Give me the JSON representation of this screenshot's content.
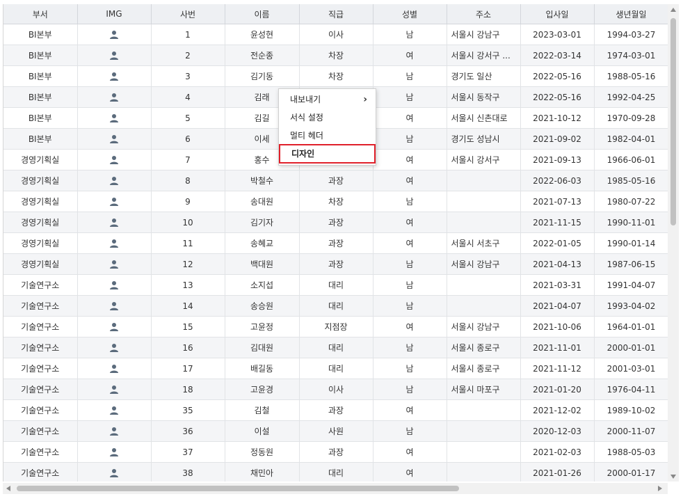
{
  "columns": [
    "부서",
    "IMG",
    "사번",
    "이름",
    "직급",
    "성별",
    "주소",
    "입사일",
    "생년월일"
  ],
  "rows": [
    {
      "dept": "BI본부",
      "id": "1",
      "name": "윤성현",
      "rank": "이사",
      "gender": "남",
      "addr": "서울시 강남구",
      "hire": "2023-03-01",
      "birth": "1994-03-27"
    },
    {
      "dept": "BI본부",
      "id": "2",
      "name": "전순종",
      "rank": "차장",
      "gender": "여",
      "addr": "서울시 강서구 ...",
      "hire": "2022-03-14",
      "birth": "1974-03-01"
    },
    {
      "dept": "BI본부",
      "id": "3",
      "name": "김기동",
      "rank": "차장",
      "gender": "남",
      "addr": "경기도 일산",
      "hire": "2022-05-16",
      "birth": "1988-05-16"
    },
    {
      "dept": "BI본부",
      "id": "4",
      "name": "김래",
      "rank": "",
      "gender": "남",
      "addr": "서울시 동작구",
      "hire": "2022-05-16",
      "birth": "1992-04-25"
    },
    {
      "dept": "BI본부",
      "id": "5",
      "name": "김길",
      "rank": "",
      "gender": "여",
      "addr": "서울시 신촌대로",
      "hire": "2021-10-12",
      "birth": "1970-09-28"
    },
    {
      "dept": "BI본부",
      "id": "6",
      "name": "이세",
      "rank": "",
      "gender": "남",
      "addr": "경기도 성남시",
      "hire": "2021-09-02",
      "birth": "1982-04-01"
    },
    {
      "dept": "경영기획실",
      "id": "7",
      "name": "홍수",
      "rank": "",
      "gender": "여",
      "addr": "서울시 강서구",
      "hire": "2021-09-13",
      "birth": "1966-06-01"
    },
    {
      "dept": "경영기획실",
      "id": "8",
      "name": "박철수",
      "rank": "과장",
      "gender": "여",
      "addr": "",
      "hire": "2022-06-03",
      "birth": "1985-05-16"
    },
    {
      "dept": "경영기획실",
      "id": "9",
      "name": "송대원",
      "rank": "차장",
      "gender": "남",
      "addr": "",
      "hire": "2021-07-13",
      "birth": "1980-07-22"
    },
    {
      "dept": "경영기획실",
      "id": "10",
      "name": "김기자",
      "rank": "과장",
      "gender": "여",
      "addr": "",
      "hire": "2021-11-15",
      "birth": "1990-11-01"
    },
    {
      "dept": "경영기획실",
      "id": "11",
      "name": "송혜교",
      "rank": "과장",
      "gender": "여",
      "addr": "서울시 서초구",
      "hire": "2022-01-05",
      "birth": "1990-01-14"
    },
    {
      "dept": "경영기획실",
      "id": "12",
      "name": "백대원",
      "rank": "과장",
      "gender": "남",
      "addr": "서울시 강남구",
      "hire": "2021-04-13",
      "birth": "1987-06-15"
    },
    {
      "dept": "기술연구소",
      "id": "13",
      "name": "소지섭",
      "rank": "대리",
      "gender": "남",
      "addr": "",
      "hire": "2021-03-31",
      "birth": "1991-04-07"
    },
    {
      "dept": "기술연구소",
      "id": "14",
      "name": "송승원",
      "rank": "대리",
      "gender": "남",
      "addr": "",
      "hire": "2021-04-07",
      "birth": "1993-04-02"
    },
    {
      "dept": "기술연구소",
      "id": "15",
      "name": "고윤정",
      "rank": "지점장",
      "gender": "여",
      "addr": "서울시 강남구",
      "hire": "2021-10-06",
      "birth": "1964-01-01"
    },
    {
      "dept": "기술연구소",
      "id": "16",
      "name": "김대원",
      "rank": "대리",
      "gender": "남",
      "addr": "서울시 종로구",
      "hire": "2021-11-01",
      "birth": "2000-01-01"
    },
    {
      "dept": "기술연구소",
      "id": "17",
      "name": "배길동",
      "rank": "대리",
      "gender": "남",
      "addr": "서울시 종로구",
      "hire": "2021-11-12",
      "birth": "2001-03-01"
    },
    {
      "dept": "기술연구소",
      "id": "18",
      "name": "고윤경",
      "rank": "이사",
      "gender": "남",
      "addr": "서울시 마포구",
      "hire": "2021-01-20",
      "birth": "1976-04-11"
    },
    {
      "dept": "기술연구소",
      "id": "35",
      "name": "김철",
      "rank": "과장",
      "gender": "여",
      "addr": "",
      "hire": "2021-12-02",
      "birth": "1989-10-02"
    },
    {
      "dept": "기술연구소",
      "id": "36",
      "name": "이설",
      "rank": "사원",
      "gender": "남",
      "addr": "",
      "hire": "2020-12-03",
      "birth": "2000-11-07"
    },
    {
      "dept": "기술연구소",
      "id": "37",
      "name": "정동원",
      "rank": "과장",
      "gender": "여",
      "addr": "",
      "hire": "2021-02-03",
      "birth": "1988-05-03"
    },
    {
      "dept": "기술연구소",
      "id": "38",
      "name": "채민아",
      "rank": "대리",
      "gender": "여",
      "addr": "",
      "hire": "2021-01-26",
      "birth": "2000-01-17"
    }
  ],
  "context_menu": {
    "items": [
      {
        "label": "내보내기",
        "has_submenu": true
      },
      {
        "label": "서식 설정",
        "has_submenu": false
      },
      {
        "label": "멀티 헤더",
        "has_submenu": false
      },
      {
        "label": "디자인",
        "has_submenu": false,
        "highlighted": true
      }
    ],
    "highlight_color": "#e0202a"
  },
  "colors": {
    "header_bg": "#eef0f3",
    "icon": "#5b6b7c",
    "stripe": "#f4f5f7"
  },
  "icons": {
    "img_cell": "person-icon"
  }
}
